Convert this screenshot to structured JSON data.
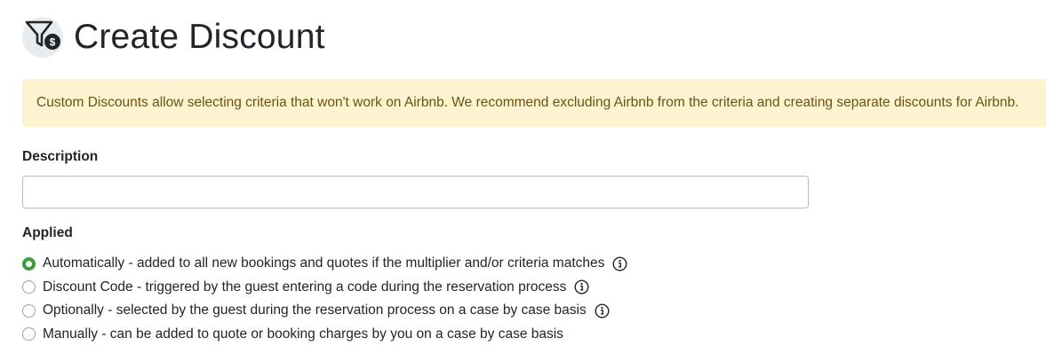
{
  "header": {
    "title": "Create Discount",
    "icon": "filter-dollar-icon"
  },
  "alert": {
    "text": "Custom Discounts allow selecting criteria that won't work on Airbnb. We recommend excluding Airbnb from the criteria and creating separate discounts for Airbnb."
  },
  "description": {
    "label": "Description",
    "value": "",
    "placeholder": ""
  },
  "applied": {
    "label": "Applied",
    "options": [
      {
        "label": "Automatically - added to all new bookings and quotes if the multiplier and/or criteria matches",
        "checked": true,
        "info": true
      },
      {
        "label": "Discount Code - triggered by the guest entering a code during the reservation process",
        "checked": false,
        "info": true
      },
      {
        "label": "Optionally - selected by the guest during the reservation process on a case by case basis",
        "checked": false,
        "info": true
      },
      {
        "label": "Manually - can be added to quote or booking charges by you on a case by case basis",
        "checked": false,
        "info": false
      }
    ]
  },
  "colors": {
    "alert_bg": "#fdf3d1",
    "alert_text": "#6b5310",
    "radio_checked": "#3a9e3a"
  }
}
